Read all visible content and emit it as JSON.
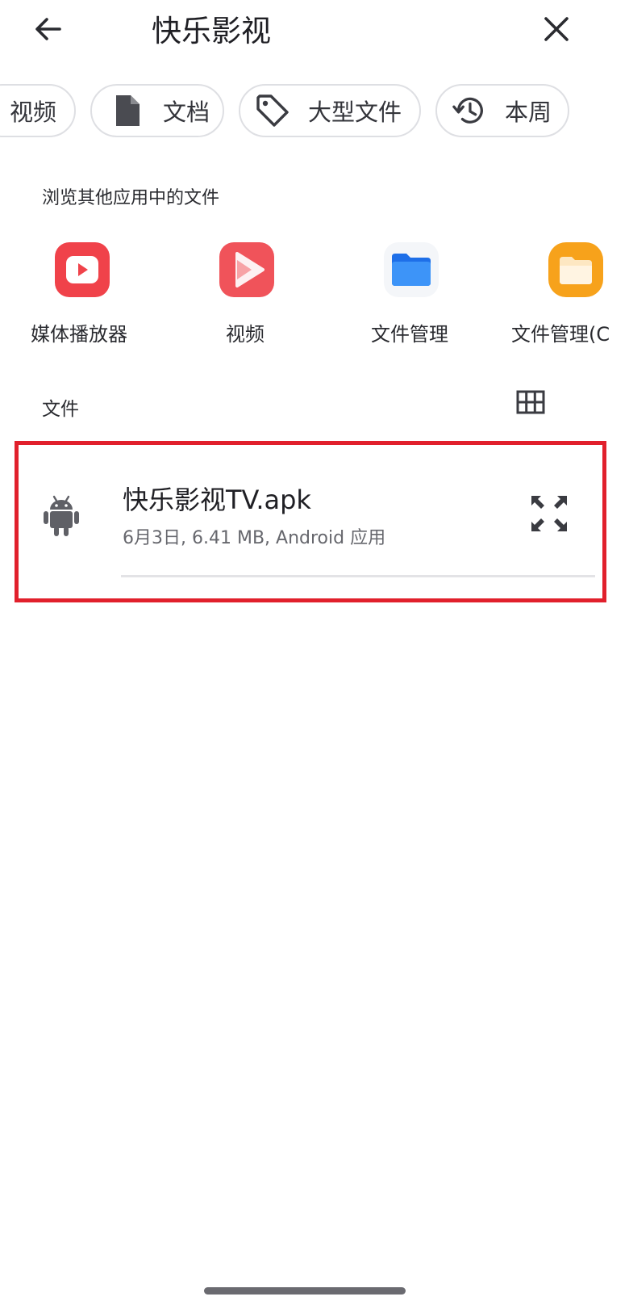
{
  "header": {
    "search_query": "快乐影视",
    "back_icon": "arrow-back-icon",
    "close_icon": "close-icon"
  },
  "chips": [
    {
      "label": "视频",
      "icon": null
    },
    {
      "label": "文档",
      "icon": "document-icon"
    },
    {
      "label": "大型文件",
      "icon": "tag-icon"
    },
    {
      "label": "本周",
      "icon": "history-icon"
    }
  ],
  "browse_section": {
    "title": "浏览其他应用中的文件",
    "apps": [
      {
        "label": "媒体播放器",
        "icon": "media-player-icon",
        "color": "#f0424a"
      },
      {
        "label": "视频",
        "icon": "video-app-icon",
        "color": "#f0535a"
      },
      {
        "label": "文件管理",
        "icon": "blue-folder-icon",
        "color": "#2f86f5"
      },
      {
        "label": "文件管理(C",
        "icon": "orange-folder-icon",
        "color": "#f7a21b"
      }
    ]
  },
  "files_section": {
    "title": "文件",
    "view_toggle_icon": "grid-view-icon",
    "items": [
      {
        "name": "快乐影视TV.apk",
        "meta": "6月3日, 6.41 MB, Android 应用",
        "icon": "android-icon",
        "action_icon": "expand-icon"
      }
    ]
  },
  "colors": {
    "highlight": "#e1202c",
    "text_primary": "#1f1f24",
    "text_secondary": "#66676d",
    "chip_border": "#dedfe3"
  }
}
